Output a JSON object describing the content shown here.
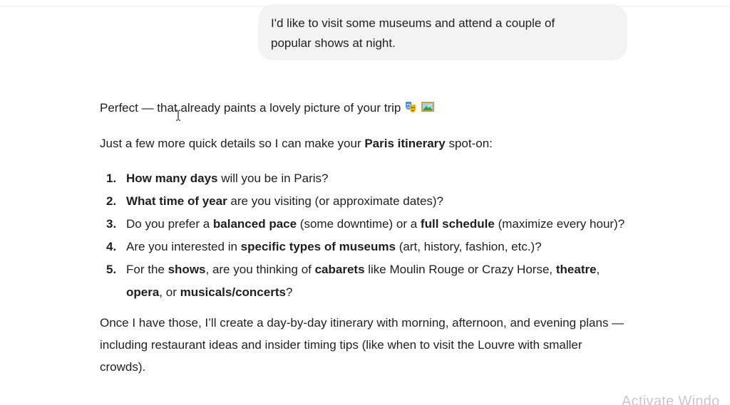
{
  "user_message": {
    "line1": "I'd like to visit some museums and attend a couple of",
    "line2": "popular shows at night."
  },
  "reply": {
    "intro": "Perfect — that already paints a lovely picture of your trip",
    "intro_emojis": [
      "performing-arts-icon",
      "framed-picture-icon"
    ],
    "lead_before": "Just a few more quick details so I can make your ",
    "lead_bold": "Paris itinerary",
    "lead_after": " spot-on:",
    "questions": [
      {
        "num": "1.",
        "b1": "How many days",
        "t1": " will you be in Paris?"
      },
      {
        "num": "2.",
        "b1": "What time of year",
        "t1": " are you visiting (or approximate dates)?"
      },
      {
        "num": "3.",
        "t0": "Do you prefer a ",
        "b1": "balanced pace",
        "t1": " (some downtime) or a ",
        "b2": "full schedule",
        "t2": " (maximize every hour)?"
      },
      {
        "num": "4.",
        "t0": "Are you interested in ",
        "b1": "specific types of museums",
        "t1": " (art, history, fashion, etc.)?"
      },
      {
        "num": "5.",
        "t0": "For the ",
        "b1": "shows",
        "t1": ", are you thinking of ",
        "b2": "cabarets",
        "t2": " like Moulin Rouge or Crazy Horse, ",
        "b3": "theatre",
        "t3": ", ",
        "b4": "opera",
        "t4": ", or ",
        "b5": "musicals/concerts",
        "t5": "?"
      }
    ],
    "closing": "Once I have those, I’ll create a day-by-day itinerary with morning, afternoon, and evening plans — including restaurant ideas and insider timing tips (like when to visit the Louvre with smaller crowds)."
  },
  "watermark": "Activate Windo",
  "colors": {
    "bubble": "#f3f3f3",
    "text": "#1f1f1f",
    "watermark": "#c8c8c8"
  }
}
